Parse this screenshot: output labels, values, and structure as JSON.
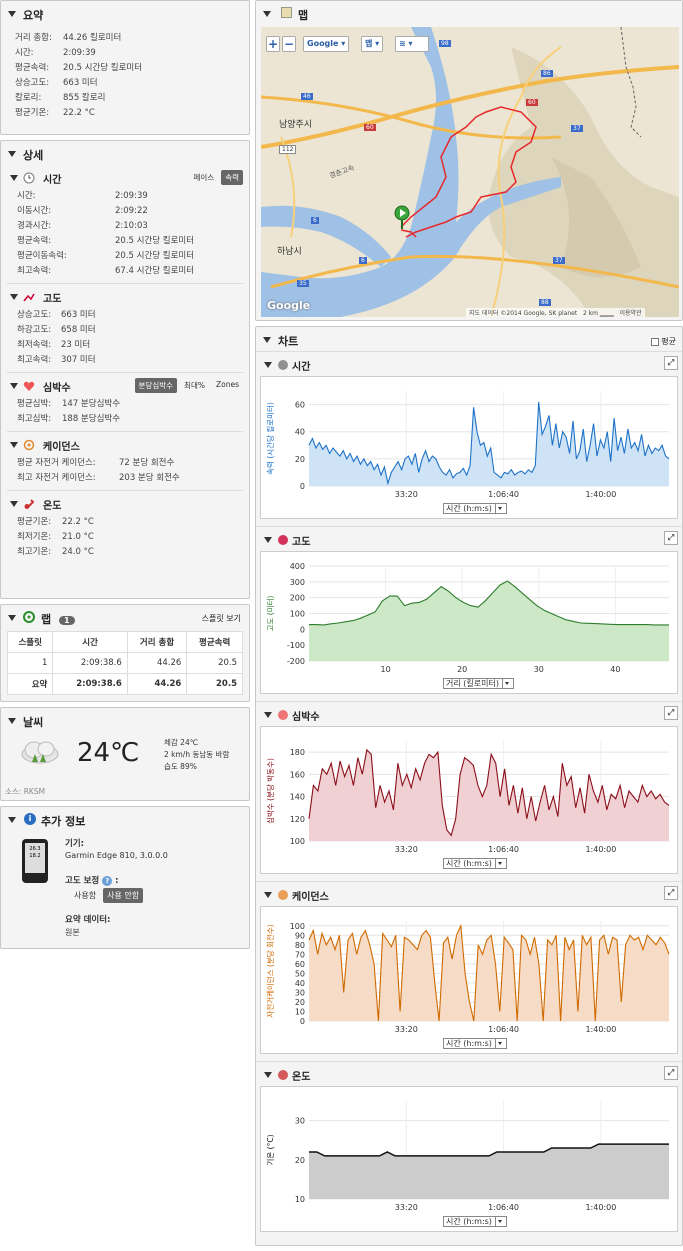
{
  "summary": {
    "title": "요약",
    "rows": [
      {
        "k": "거리 총합:",
        "v": "44.26 킬로미터"
      },
      {
        "k": "시간:",
        "v": "2:09:39"
      },
      {
        "k": "평균속력:",
        "v": "20.5 시간당 킬로미터"
      },
      {
        "k": "상승고도:",
        "v": "663 미터"
      },
      {
        "k": "칼로리:",
        "v": "855 칼로리"
      },
      {
        "k": "평균기온:",
        "v": "22.2 °C"
      }
    ]
  },
  "detail": {
    "title": "상세",
    "time": {
      "title": "시간",
      "tabs": [
        "페이스",
        "속력"
      ],
      "rows": [
        {
          "k": "시간:",
          "v": "2:09:39"
        },
        {
          "k": "이동시간:",
          "v": "2:09:22"
        },
        {
          "k": "경과시간:",
          "v": "2:10:03"
        },
        {
          "k": "평균속력:",
          "v": "20.5 시간당 킬로미터"
        },
        {
          "k": "평균이동속력:",
          "v": "20.5 시간당 킬로미터"
        },
        {
          "k": "최고속력:",
          "v": "67.4 시간당 킬로미터"
        }
      ]
    },
    "elev": {
      "title": "고도",
      "rows": [
        {
          "k": "상승고도:",
          "v": "663 미터"
        },
        {
          "k": "하강고도:",
          "v": "658 미터"
        },
        {
          "k": "최저속력:",
          "v": "23 미터"
        },
        {
          "k": "최고속력:",
          "v": "307 미터"
        }
      ]
    },
    "hr": {
      "title": "심박수",
      "tabs": [
        "분당심박수",
        "최대%",
        "Zones"
      ],
      "rows": [
        {
          "k": "평균심박:",
          "v": "147 분당심박수"
        },
        {
          "k": "최고심박:",
          "v": "188 분당심박수"
        }
      ]
    },
    "cad": {
      "title": "케이던스",
      "rows": [
        {
          "k": "평균 자전거 케이던스:",
          "v": "72 분당 회전수"
        },
        {
          "k": "최고 자전거 케이던스:",
          "v": "203 분당 회전수"
        }
      ]
    },
    "temp": {
      "title": "온도",
      "rows": [
        {
          "k": "평균기온:",
          "v": "22.2 °C"
        },
        {
          "k": "최저기온:",
          "v": "21.0 °C"
        },
        {
          "k": "최고기온:",
          "v": "24.0 °C"
        }
      ]
    }
  },
  "laps": {
    "title": "랩",
    "count": "1",
    "split_view": "스플릿 보기",
    "headers": [
      "스플릿",
      "시간",
      "거리 총합",
      "평균속력"
    ],
    "rows": [
      [
        "1",
        "2:09:38.6",
        "44.26",
        "20.5"
      ],
      [
        "요약",
        "2:09:38.6",
        "44.26",
        "20.5"
      ]
    ]
  },
  "weather": {
    "title": "날씨",
    "temp": "24℃",
    "lines": [
      "체감 24℃",
      "2 km/h 동남동 바람",
      "습도 89%"
    ],
    "source": "소스: RKSM"
  },
  "extra": {
    "title": "추가 정보",
    "device_label": "기기:",
    "device": "Garmin Edge 810, 3.0.0.0",
    "elev_corr_label": "고도 보정",
    "elev_corr_options": [
      "사용함",
      "사용 안함"
    ],
    "summary_data_label": "요약 데이터:",
    "summary_data": "원본",
    "device_screen": [
      "26.3",
      "18.2"
    ]
  },
  "map": {
    "title": "맵",
    "zoom_in": "+",
    "zoom_out": "−",
    "layer": "Google",
    "map_type": "맵",
    "labels": [
      "남양주시",
      "하남시",
      "경춘고속"
    ],
    "route_shields": [
      "46",
      "60",
      "98",
      "86",
      "37",
      "112",
      "6",
      "37",
      "35",
      "88",
      "60",
      "6"
    ],
    "attribution": "지도 데이터 ©2014 Google, SK planet",
    "scale": "2 km",
    "terms": "이용약관",
    "logo": "Google"
  },
  "charts": {
    "title": "차트",
    "avg_label": "평균",
    "speed": {
      "title": "시간",
      "ylabel": "속력 (시간당 킬로미터)",
      "xsel": "시간 (h:m:s)"
    },
    "elev": {
      "title": "고도",
      "ylabel": "고도 (미터)",
      "xsel": "거리 (킬로미터)"
    },
    "hr": {
      "title": "심박수",
      "ylabel": "심박수 (분당 박동수)",
      "xsel": "시간 (h:m:s)"
    },
    "cad": {
      "title": "케이던스",
      "ylabel": "자전거케이던스 (분당 회전수)",
      "xsel": "시간 (h:m:s)"
    },
    "temp": {
      "title": "온도",
      "ylabel": "기온 (°C)",
      "xsel": "시간 (h:m:s)"
    }
  },
  "chart_data": [
    {
      "type": "area",
      "ylabel": "속력 (시간당 킬로미터)",
      "xlabel": "시간 (h:m:s)",
      "ylim": [
        0,
        70
      ],
      "yticks": [
        0,
        20,
        40,
        60
      ],
      "xticks": [
        "33:20",
        "1:06:40",
        "1:40:00"
      ],
      "color": "#1e73c8",
      "fill": "#cfe3f7",
      "values": [
        30,
        35,
        28,
        32,
        27,
        30,
        24,
        28,
        25,
        22,
        26,
        20,
        24,
        18,
        22,
        16,
        20,
        15,
        18,
        12,
        16,
        8,
        14,
        2,
        10,
        14,
        18,
        12,
        20,
        22,
        16,
        24,
        10,
        20,
        26,
        18,
        22,
        20,
        14,
        10,
        8,
        12,
        6,
        9,
        10,
        13,
        8,
        15,
        58,
        40,
        30,
        32,
        22,
        28,
        10,
        8,
        6,
        10,
        9,
        12,
        8,
        10,
        11,
        9,
        12,
        10,
        15,
        62,
        38,
        44,
        52,
        30,
        46,
        28,
        40,
        36,
        24,
        48,
        20,
        26,
        42,
        18,
        30,
        46,
        22,
        34,
        28,
        40,
        18,
        50,
        26,
        36,
        24,
        42,
        28,
        32,
        26,
        38,
        22,
        30,
        24,
        28,
        26,
        30,
        22,
        20
      ]
    },
    {
      "type": "area",
      "ylabel": "고도 (미터)",
      "xlabel": "거리 (킬로미터)",
      "ylim": [
        -200,
        400
      ],
      "yticks": [
        -200,
        -100,
        0,
        100,
        200,
        300,
        400
      ],
      "xticks": [
        "10",
        "20",
        "30",
        "40"
      ],
      "color": "#2e7d2e",
      "fill": "#cde8c6",
      "values": [
        30,
        30,
        28,
        35,
        40,
        48,
        55,
        70,
        90,
        110,
        180,
        210,
        210,
        150,
        165,
        170,
        190,
        230,
        270,
        240,
        200,
        170,
        150,
        140,
        180,
        230,
        280,
        305,
        270,
        230,
        190,
        150,
        120,
        100,
        80,
        60,
        50,
        40,
        38,
        36,
        34,
        32,
        30,
        30,
        30,
        30,
        30,
        28,
        28,
        28
      ]
    },
    {
      "type": "area",
      "ylabel": "심박수 (분당 박동수)",
      "xlabel": "시간 (h:m:s)",
      "ylim": [
        100,
        190
      ],
      "yticks": [
        100,
        120,
        140,
        160,
        180
      ],
      "xticks": [
        "33:20",
        "1:06:40",
        "1:40:00"
      ],
      "color": "#8b0f1a",
      "fill": "#f0d0d2",
      "values": [
        120,
        150,
        145,
        165,
        160,
        170,
        150,
        172,
        158,
        168,
        150,
        175,
        160,
        182,
        178,
        130,
        150,
        135,
        145,
        128,
        170,
        150,
        160,
        148,
        165,
        155,
        170,
        178,
        175,
        180,
        132,
        110,
        105,
        120,
        160,
        175,
        172,
        168,
        150,
        140,
        150,
        178,
        170,
        140,
        165,
        132,
        150,
        125,
        148,
        120,
        140,
        118,
        135,
        150,
        128,
        140,
        122,
        170,
        150,
        158,
        130,
        148,
        125,
        160,
        145,
        135,
        150,
        128,
        142,
        138,
        150,
        130,
        145,
        140,
        135,
        150,
        140,
        145,
        138,
        142,
        135,
        132
      ]
    },
    {
      "type": "area",
      "ylabel": "자전거케이던스 (분당 회전수)",
      "xlabel": "시간 (h:m:s)",
      "ylim": [
        0,
        105
      ],
      "yticks": [
        0,
        10,
        20,
        30,
        40,
        50,
        60,
        70,
        80,
        90,
        100
      ],
      "xticks": [
        "33:20",
        "1:06:40",
        "1:40:00"
      ],
      "color": "#d06a00",
      "fill": "#f6dcc6",
      "values": [
        85,
        95,
        70,
        92,
        80,
        88,
        75,
        90,
        30,
        85,
        92,
        70,
        88,
        95,
        80,
        60,
        0,
        92,
        85,
        78,
        90,
        10,
        88,
        85,
        80,
        75,
        90,
        95,
        88,
        40,
        0,
        82,
        88,
        65,
        90,
        100,
        50,
        20,
        0,
        80,
        70,
        85,
        90,
        60,
        10,
        88,
        82,
        75,
        0,
        90,
        85,
        70,
        88,
        60,
        0,
        85,
        80,
        90,
        0,
        88,
        75,
        85,
        10,
        90,
        80,
        88,
        0,
        85,
        90,
        70,
        88,
        85,
        20,
        80,
        90,
        85,
        88,
        75,
        90,
        85,
        80,
        88,
        82,
        70
      ]
    },
    {
      "type": "area",
      "ylabel": "기온 (°C)",
      "xlabel": "시간 (h:m:s)",
      "ylim": [
        10,
        35
      ],
      "yticks": [
        10,
        20,
        30
      ],
      "xticks": [
        "33:20",
        "1:06:40",
        "1:40:00"
      ],
      "color": "#111111",
      "fill": "#cccccc",
      "values": [
        22,
        22,
        21,
        21,
        21,
        21,
        21,
        21,
        21,
        21,
        22,
        21,
        21,
        21,
        21,
        21,
        21,
        21,
        21,
        21,
        21,
        21,
        21,
        21,
        22,
        22,
        22,
        22,
        22,
        22,
        22,
        23,
        23,
        23,
        23,
        23,
        23,
        24,
        24,
        24,
        24,
        24,
        24,
        24,
        24,
        24,
        24
      ]
    }
  ]
}
